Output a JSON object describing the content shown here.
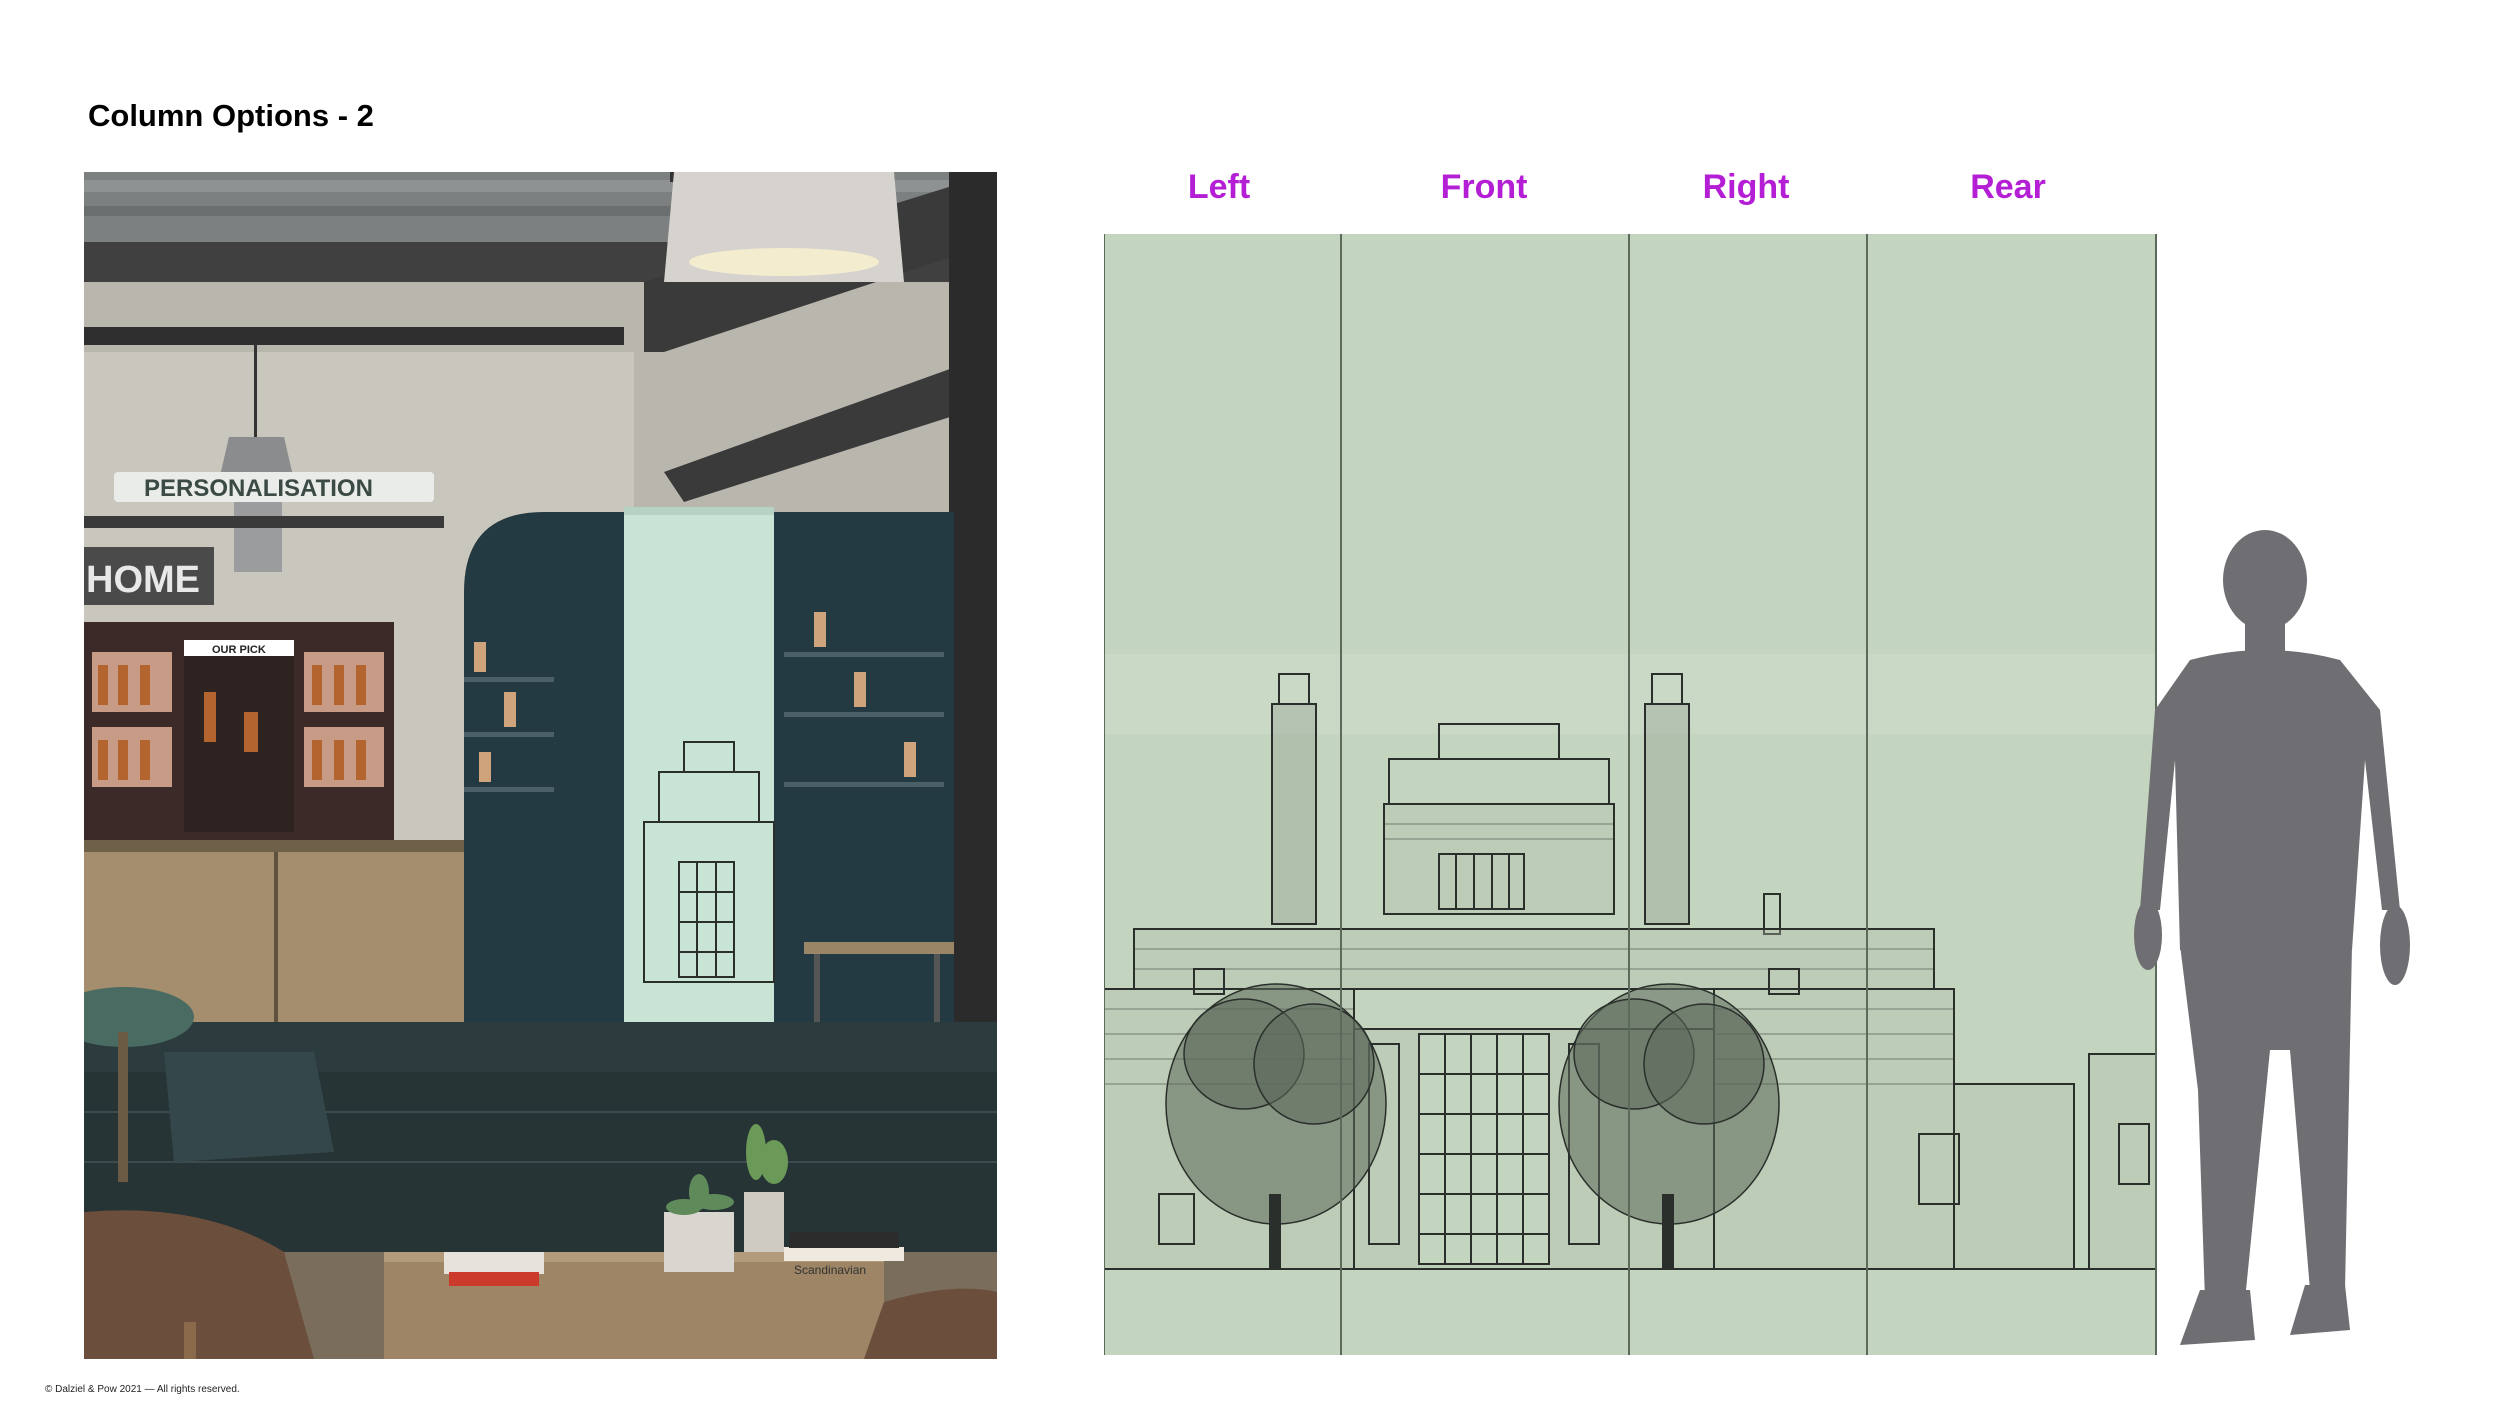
{
  "page": {
    "title": "Column Options - 2",
    "footer": "© Dalziel & Pow 2021 — All rights reserved."
  },
  "render": {
    "signs": {
      "personalisation": "PERSONALISATION",
      "home": "HOME",
      "our_pick": "OUR PICK",
      "book": "Scandinavian"
    }
  },
  "column_wrap": {
    "panels": [
      {
        "label": "Left"
      },
      {
        "label": "Front"
      },
      {
        "label": "Right"
      },
      {
        "label": "Rear"
      }
    ],
    "colors": {
      "background": "#c3d4bf",
      "label": "#b41fd6",
      "divider": "#5b6a5a",
      "sketch": "#2b2f2b"
    }
  },
  "scale_figure": {
    "color": "#6f6f73"
  }
}
